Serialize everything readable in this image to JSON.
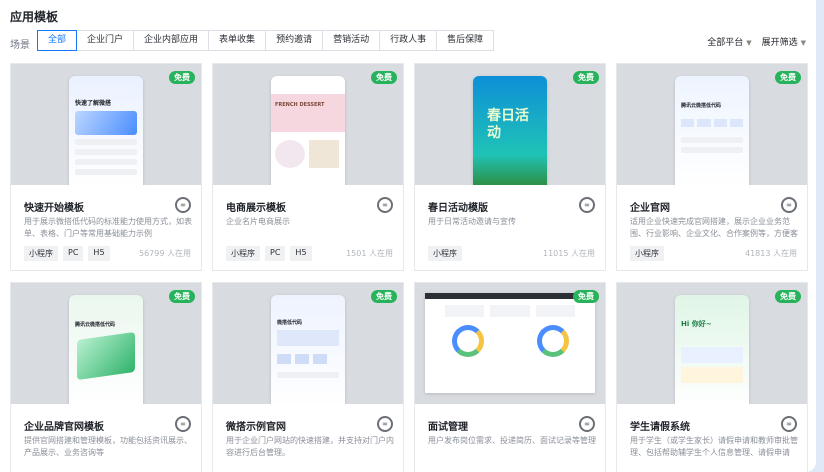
{
  "page": {
    "title": "应用模板"
  },
  "filters": {
    "label": "场景",
    "tabs": [
      "全部",
      "企业门户",
      "企业内部应用",
      "表单收集",
      "预约邀请",
      "营销活动",
      "行政人事",
      "售后保障"
    ],
    "platform": "全部平台",
    "expand": "展开筛选"
  },
  "templates": [
    {
      "name": "快速开始模板",
      "desc": "用于展示微搭低代码的标准能力使用方式，如表单、表格、门户等常用基础能力示例",
      "tags": [
        "小程序",
        "PC",
        "H5"
      ],
      "usage": "56799 人在用",
      "badge": "免费",
      "screen_title": "快速了解微搭"
    },
    {
      "name": "电商展示模板",
      "desc": "企业名片电商展示",
      "tags": [
        "小程序",
        "PC",
        "H5"
      ],
      "usage": "1501 人在用",
      "badge": "免费",
      "screen_title": "FRENCH DESSERT"
    },
    {
      "name": "春日活动模版",
      "desc": "用于日常活动邀请与宣传",
      "tags": [
        "小程序"
      ],
      "usage": "11015 人在用",
      "badge": "免费",
      "screen_title": "春日活动"
    },
    {
      "name": "企业官网",
      "desc": "适用企业快速完成官网搭建，展示企业业务范围、行业影响、企业文化、合作案例等，方便客户全…",
      "tags": [
        "小程序"
      ],
      "usage": "41813 人在用",
      "badge": "免费",
      "screen_title": "腾讯云微搭低代码"
    },
    {
      "name": "企业品牌官网模板",
      "desc": "提供官网搭建和管理模板，功能包括资讯展示、产品展示、业务咨询等",
      "tags": [],
      "usage": "",
      "badge": "免费",
      "screen_title": "腾讯云微搭低代码"
    },
    {
      "name": "微搭示例官网",
      "desc": "用于企业门户网站的快速搭建，并支持对门户内容进行后台管理。",
      "tags": [],
      "usage": "",
      "badge": "免费",
      "screen_title": "微搭低代码"
    },
    {
      "name": "面试管理",
      "desc": "用户发布岗位需求、投递简历、面试记录等管理",
      "tags": [],
      "usage": "",
      "badge": "免费",
      "screen_title": ""
    },
    {
      "name": "学生请假系统",
      "desc": "用于学生（或学生家长）请假申请和教师审批管理、包括帮助辅学生个人信息管理、请假申请",
      "tags": [],
      "usage": "",
      "badge": "免费",
      "screen_title": "Hi 你好~"
    }
  ]
}
